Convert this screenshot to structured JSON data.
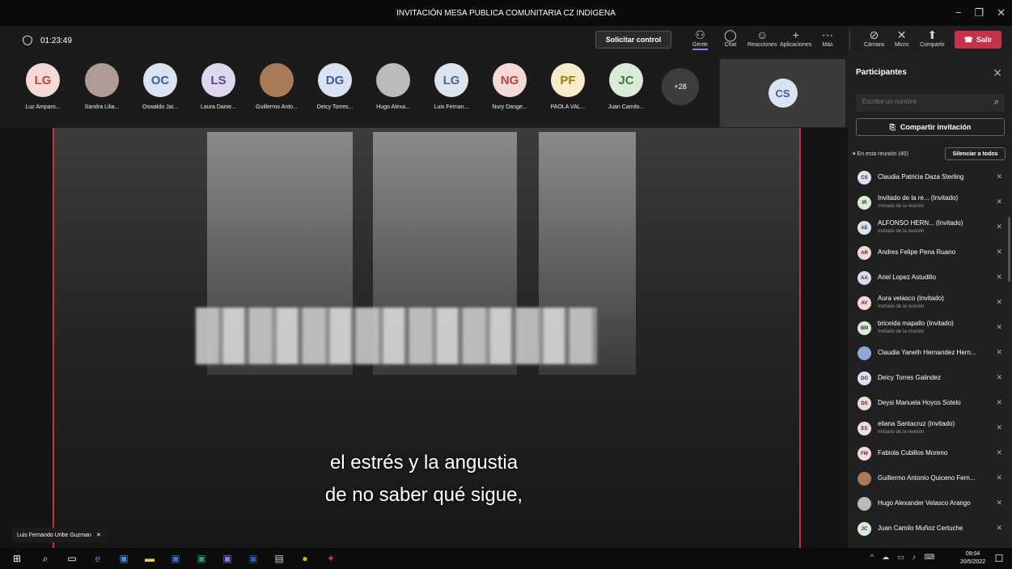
{
  "window": {
    "title": "INVITACIÓN MESA PUBLICA COMUNITARIA CZ INDIGENA",
    "controls": [
      "−",
      "❐",
      "✕"
    ]
  },
  "toolbar": {
    "timer": "01:23:49",
    "request_control": "Solicitar control",
    "people": "Gente",
    "chat": "Chat",
    "reactions": "Reacciones",
    "apps": "Aplicaciones",
    "more": "Más",
    "camera": "Cámara",
    "mic": "Micro",
    "share": "Compartir",
    "leave": "Salir",
    "leave_color": "#c4314b"
  },
  "participants_strip": [
    {
      "initials": "LG",
      "name": "Luz Amparo...",
      "color": "#f4d9d6"
    },
    {
      "initials": "",
      "name": "Sandra Lilia...",
      "color": "#b09c95"
    },
    {
      "initials": "OC",
      "name": "Oswaldo Jai...",
      "color": "#dbe3f3"
    },
    {
      "initials": "LS",
      "name": "Laura Danie...",
      "color": "#ddd8ee"
    },
    {
      "initials": "",
      "name": "Guillermo Anto...",
      "color": "#a87a55"
    },
    {
      "initials": "DG",
      "name": "Deicy Torres...",
      "color": "#dbe3f3"
    },
    {
      "initials": "",
      "name": "Hugo Alexa...",
      "color": "#bbbbbb"
    },
    {
      "initials": "LG",
      "name": "Luis Fernan...",
      "color": "#dce4ef"
    },
    {
      "initials": "NG",
      "name": "Nury Dange...",
      "color": "#f4d9d6"
    },
    {
      "initials": "PF",
      "name": "PAOLA VAL...",
      "color": "#f6ecc8"
    },
    {
      "initials": "JC",
      "name": "Juan Camilo...",
      "color": "#d9ecd9"
    }
  ],
  "more_count": "+28",
  "self_view": {
    "initials": "CS"
  },
  "video": {
    "caption_line1": "el estrés y la angustia",
    "caption_line2": "de no saber qué sigue,",
    "presenter": "Luis Fernando Uribe Guzman"
  },
  "panel": {
    "title": "Participantes",
    "search_placeholder": "Escribe un nombre",
    "share_invite": "Compartir invitación",
    "in_meeting": "En esta reunión (40)",
    "mute_all": "Silenciar a todos",
    "people": [
      {
        "initials": "CS",
        "name": "Claudia Patricia Daza Sterling",
        "sub": "",
        "color": "#dbe3f3"
      },
      {
        "initials": "IR",
        "name": "Invitado de la re... (Invitado)",
        "sub": "Invitado de la reunión",
        "color": "#d9ecd9"
      },
      {
        "initials": "AE",
        "name": "ALFONSO HERN... (Invitado)",
        "sub": "Invitado de la reunión",
        "color": "#dbe3f3"
      },
      {
        "initials": "AR",
        "name": "Andres Felipe Pena Ruano",
        "sub": "",
        "color": "#f4d9d6"
      },
      {
        "initials": "AA",
        "name": "Ariel Lopez Astudillo",
        "sub": "",
        "color": "#ddd8ee"
      },
      {
        "initials": "AV",
        "name": "Aura velasco (Invitado)",
        "sub": "Invitado de la reunión",
        "color": "#f4d9d6"
      },
      {
        "initials": "BM",
        "name": "briceida mapallo (Invitado)",
        "sub": "Invitado de la reunión",
        "color": "#d9ecd9"
      },
      {
        "initials": "",
        "name": "Claudia Yaneth Hernandez Hern...",
        "sub": "",
        "color": "#8fa7d6"
      },
      {
        "initials": "DG",
        "name": "Deicy Torres Galindez",
        "sub": "",
        "color": "#dbe3f3"
      },
      {
        "initials": "DS",
        "name": "Deysi Manuela Hoyos Sotelo",
        "sub": "",
        "color": "#f4d9d6"
      },
      {
        "initials": "ES",
        "name": "eliana Santacruz (Invitado)",
        "sub": "Invitado de la reunión",
        "color": "#f4d9e8"
      },
      {
        "initials": "FM",
        "name": "Fabiola Cubillos Moreno",
        "sub": "",
        "color": "#f4d9d6"
      },
      {
        "initials": "",
        "name": "Guillermo Antonio Quiceno Fern...",
        "sub": "",
        "color": "#a87a55"
      },
      {
        "initials": "",
        "name": "Hugo Alexander Velasco Arango",
        "sub": "",
        "color": "#bbbbbb"
      },
      {
        "initials": "JC",
        "name": "Juan Camilo Muñoz Certuche",
        "sub": "",
        "color": "#d9ecd9"
      }
    ]
  },
  "taskbar": {
    "time": "09:04",
    "date": "20/5/2022"
  }
}
